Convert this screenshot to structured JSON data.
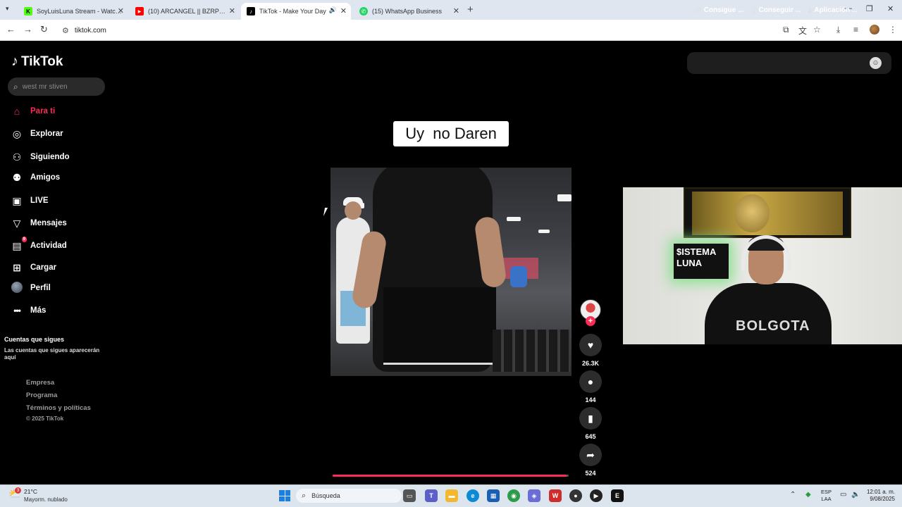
{
  "browser": {
    "tabs": [
      {
        "title": "SoyLuisLuna Stream - Watch Li",
        "favicon_color": "#53fc18",
        "favicon_glyph": "K"
      },
      {
        "title": "(10) ARCANGEL || BZRP Music S",
        "favicon_color": "#ff0000",
        "favicon_glyph": "▶"
      },
      {
        "title": "TikTok - Make Your Day",
        "favicon_color": "#000000",
        "favicon_glyph": "♪"
      },
      {
        "title": "(15) WhatsApp Business",
        "favicon_color": "#25d366",
        "favicon_glyph": "✆"
      }
    ],
    "url": "tiktok.com"
  },
  "tiktok": {
    "brand": "TikTok",
    "search_placeholder": "west mr stiven",
    "menu": [
      {
        "label": "Para ti",
        "icon": "home-icon",
        "glyph": "⌂",
        "active": true
      },
      {
        "label": "Explorar",
        "icon": "compass-icon",
        "glyph": "◎"
      },
      {
        "label": "Siguiendo",
        "icon": "following-icon",
        "glyph": "⚇"
      },
      {
        "label": "Amigos",
        "icon": "friends-icon",
        "glyph": "⚉"
      },
      {
        "label": "LIVE",
        "icon": "live-icon",
        "glyph": "▣"
      },
      {
        "label": "Mensajes",
        "icon": "messages-icon",
        "glyph": "▽"
      },
      {
        "label": "Actividad",
        "icon": "activity-icon",
        "glyph": "▤",
        "badge": "9"
      },
      {
        "label": "Cargar",
        "icon": "upload-icon",
        "glyph": "⊞"
      },
      {
        "label": "Perfil",
        "icon": "profile-avatar",
        "glyph": ""
      },
      {
        "label": "Más",
        "icon": "more-icon",
        "glyph": "···"
      }
    ],
    "following_title": "Cuentas que sigues",
    "following_desc": "Las cuentas que sigues aparecerán aquí",
    "footer_links": [
      "Empresa",
      "Programa",
      "Términos y políticas"
    ],
    "copyright": "© 2025 TikTok",
    "top_actions": [
      "Consigue ...",
      "Conseguir ...",
      "Aplicación ..."
    ],
    "caption": "Uy  no Daren",
    "playback_progress": 0.99,
    "stats": {
      "likes": "26.3K",
      "comments": "144",
      "saves": "645",
      "shares": "524"
    },
    "accent_color": "#fe2c55"
  },
  "webcam": {
    "sign_text": "$ISTEMA LUNA",
    "shirt_text": "BOLGOTA"
  },
  "taskbar": {
    "weather_temp": "21°C",
    "weather_desc": "Mayorm. nublado",
    "weather_badge": "3",
    "search_label": "Búsqueda",
    "lang_line1": "ESP",
    "lang_line2": "LAA",
    "time": "12:01 a. m.",
    "date": "9/08/2025"
  }
}
